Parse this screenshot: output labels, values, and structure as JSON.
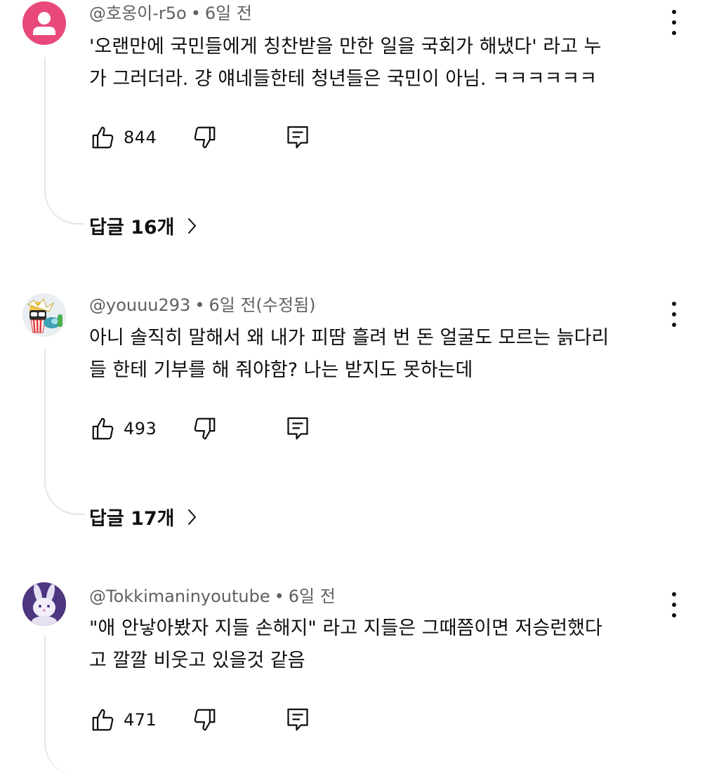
{
  "comments": [
    {
      "handle": "@호옹이-r5o",
      "time": "6일 전",
      "text_lines": [
        "'오랜만에 국민들에게 칭찬받을 만한 일을 국회가 해냈다' 라고 누",
        "가 그러더라. 걍 얘네들한테 청년들은 국민이 아님. ㅋㅋㅋㅋㅋㅋ"
      ],
      "likes": "844",
      "replies_label": "답글 16개",
      "avatar": "default-person-pink"
    },
    {
      "handle": "@youuu293",
      "time": "6일 전(수정됨)",
      "text_lines": [
        "아니 솔직히 말해서 왜 내가 피땀 흘려 번 돈 얼굴도 모르는 늙다리",
        "들 한테 기부를 해 줘야함? 나는 받지도 못하는데"
      ],
      "likes": "493",
      "replies_label": "답글 17개",
      "avatar": "popcorn-character"
    },
    {
      "handle": "@Tokkimaninyoutube",
      "time": "6일 전",
      "text_lines": [
        "\"애 안낳아봤자 지들 손해지\" 라고 지들은 그때쯤이면 저승런했다",
        "고 깔깔 비웃고 있을것 같음"
      ],
      "likes": "471",
      "avatar": "white-bunny"
    }
  ],
  "icons": {
    "like": "thumbs-up-icon",
    "dislike": "thumbs-down-icon",
    "reply": "reply-icon",
    "more": "more-vertical-icon",
    "chevron": "chevron-right-icon"
  },
  "colors": {
    "avatar_pink": "#e8487a",
    "meta_gray": "#606060",
    "thread_line": "#e5e5e5"
  }
}
